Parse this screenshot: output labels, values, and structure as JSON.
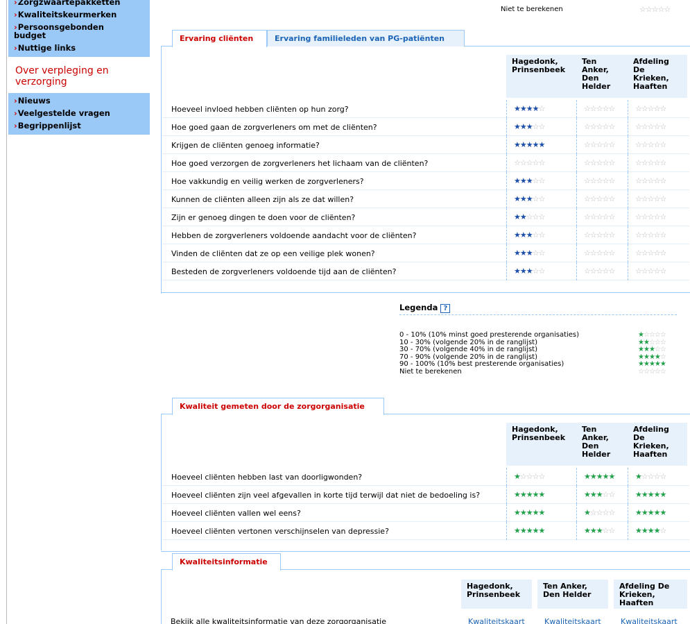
{
  "sidebar": {
    "block1": [
      {
        "label": "Zorgzwaartepakketten"
      },
      {
        "label": "Kwaliteitskeurmerken"
      },
      {
        "label": "Persoonsgebonden budget"
      },
      {
        "label": "Nuttige links"
      }
    ],
    "heading": "Over verpleging en verzorging",
    "block2": [
      {
        "label": "Nieuws"
      },
      {
        "label": "Veelgestelde vragen"
      },
      {
        "label": "Begrippenlijst"
      }
    ]
  },
  "top": {
    "label": "Niet te berekenen",
    "stars": 0
  },
  "section1": {
    "tabs": [
      "Ervaring cliënten",
      "Ervaring familieleden van PG-patiënten"
    ],
    "columns": [
      "Hagedonk, Prinsenbeek",
      "Ten Anker, Den Helder",
      "Afdeling De Krieken, Haaften"
    ],
    "rows": [
      {
        "q": "Hoeveel invloed hebben cliënten op hun zorg?",
        "r": [
          4,
          0,
          0
        ]
      },
      {
        "q": "Hoe goed gaan de zorgverleners om met de cliënten?",
        "r": [
          3,
          0,
          0
        ]
      },
      {
        "q": "Krijgen de cliënten genoeg informatie?",
        "r": [
          5,
          0,
          0
        ]
      },
      {
        "q": "Hoe goed verzorgen de zorgverleners het lichaam van de cliënten?",
        "r": [
          0,
          0,
          0
        ]
      },
      {
        "q": "Hoe vakkundig en veilig werken de zorgverleners?",
        "r": [
          3,
          0,
          0
        ]
      },
      {
        "q": "Kunnen de cliënten alleen zijn als ze dat willen?",
        "r": [
          3,
          0,
          0
        ]
      },
      {
        "q": "Zijn er genoeg dingen te doen voor de cliënten?",
        "r": [
          2,
          0,
          0
        ]
      },
      {
        "q": "Hebben de zorgverleners voldoende aandacht voor de cliënten?",
        "r": [
          3,
          0,
          0
        ]
      },
      {
        "q": "Vinden de cliënten dat ze op een veilige plek wonen?",
        "r": [
          3,
          0,
          0
        ]
      },
      {
        "q": "Besteden de zorgverleners voldoende tijd aan de cliënten?",
        "r": [
          3,
          0,
          0
        ]
      }
    ]
  },
  "legend": {
    "title": "Legenda",
    "help": "?",
    "rows": [
      {
        "t": "0 - 10% (10% minst goed presterende organisaties)",
        "s": 1
      },
      {
        "t": "10 - 30% (volgende 20% in de ranglijst)",
        "s": 2
      },
      {
        "t": "30 - 70% (volgende 40% in de ranglijst)",
        "s": 3
      },
      {
        "t": "70 - 90% (volgende 20% in de ranglijst)",
        "s": 4
      },
      {
        "t": "90 - 100% (10% best presterende organisaties)",
        "s": 5
      },
      {
        "t": "Niet te berekenen",
        "s": 0
      }
    ]
  },
  "section2": {
    "tab": "Kwaliteit gemeten door de zorgorganisatie",
    "columns": [
      "Hagedonk, Prinsenbeek",
      "Ten Anker, Den Helder",
      "Afdeling De Krieken, Haaften"
    ],
    "rows": [
      {
        "q": "Hoeveel cliënten hebben last van doorligwonden?",
        "r": [
          1,
          5,
          1
        ]
      },
      {
        "q": "Hoeveel cliënten zijn veel afgevallen in korte tijd terwijl dat niet de bedoeling is?",
        "r": [
          5,
          3,
          5
        ]
      },
      {
        "q": "Hoeveel cliënten vallen wel eens?",
        "r": [
          5,
          1,
          5
        ]
      },
      {
        "q": "Hoeveel cliënten vertonen verschijnselen van depressie?",
        "r": [
          5,
          3,
          4
        ]
      }
    ]
  },
  "section3": {
    "tab": "Kwaliteitsinformatie",
    "columns": [
      "Hagedonk, Prinsenbeek",
      "Ten Anker, Den Helder",
      "Afdeling De Krieken, Haaften"
    ],
    "row_label": "Bekijk alle kwaliteitsinformatie van deze zorgorganisatie",
    "links": [
      "Kwaliteitskaart",
      "Kwaliteitskaart",
      "Kwaliteitskaart"
    ]
  },
  "colors": {
    "accent_red": "#cc0000",
    "sidebar_blue": "#9bc9f7",
    "link_blue": "#1a63b5",
    "star_blue": "#1c4fa8",
    "star_green": "#22a04a"
  }
}
